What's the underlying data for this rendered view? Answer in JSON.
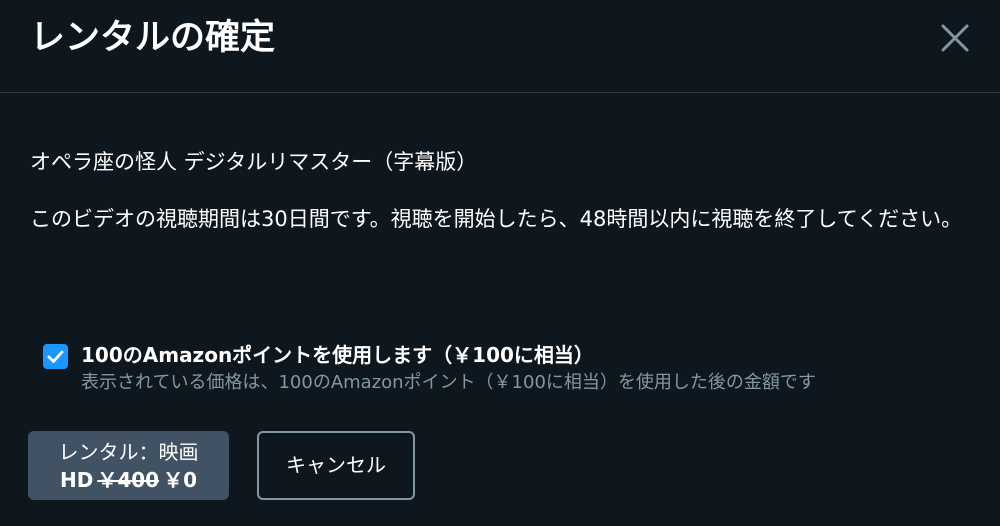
{
  "dialog": {
    "title": "レンタルの確定",
    "close_icon": "close-icon"
  },
  "video": {
    "title": "オペラ座の怪人 デジタルリマスター（字幕版）"
  },
  "description": "このビデオの視聴期間は30日間です。視聴を開始したら、48時間以内に視聴を終了してください。",
  "points": {
    "checked": true,
    "checkbox_icon": "checkmark-icon",
    "label": "100のAmazonポイントを使用します（￥100に相当）",
    "note": "表示されている価格は、100のAmazonポイント（￥100に相当）を使用した後の金額です"
  },
  "actions": {
    "rent_label": "レンタル：映画",
    "rent_quality": "HD",
    "rent_old_price": "￥400",
    "rent_new_price": "￥0",
    "cancel_label": "キャンセル"
  },
  "colors": {
    "background": "#0f171e",
    "accent": "#1a98ff",
    "primary_button": "#425265",
    "muted_text": "#8197a4"
  }
}
